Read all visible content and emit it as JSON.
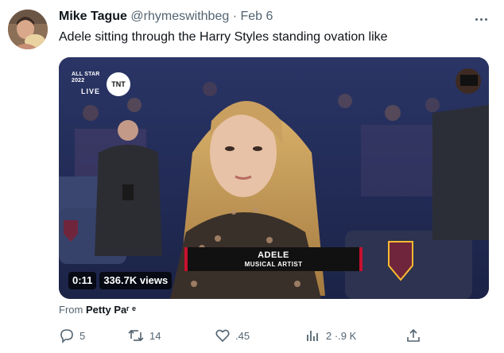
{
  "tweet": {
    "display_name": "Mike Tague",
    "handle": "@rhymeswithbeg",
    "separator": "·",
    "date": "Feb 6",
    "text": "Adele sitting through the Harry Styles standing ovation like"
  },
  "video": {
    "broadcast_bug": "ALL STAR 2022",
    "live_label": "LIVE",
    "network": "TNT",
    "lower_third_name": "ADELE",
    "lower_third_role": "MUSICAL ARTIST",
    "duration": "0:11",
    "views": "336.7K views"
  },
  "source": {
    "prefix": "From",
    "name": "Petty Paʳ ᵉ"
  },
  "actions": [
    {
      "name": "reply",
      "icon": "reply-icon",
      "count": "5"
    },
    {
      "name": "retweet",
      "icon": "retweet-icon",
      "count": "14"
    },
    {
      "name": "like",
      "icon": "like-icon",
      "count": ".45"
    },
    {
      "name": "views",
      "icon": "views-icon",
      "count": "2 ·.9 K"
    },
    {
      "name": "share",
      "icon": "share-icon",
      "count": ""
    }
  ],
  "colors": {
    "text_primary": "#0f1419",
    "text_secondary": "#536471",
    "lower_third_accent": "#c8102e"
  }
}
